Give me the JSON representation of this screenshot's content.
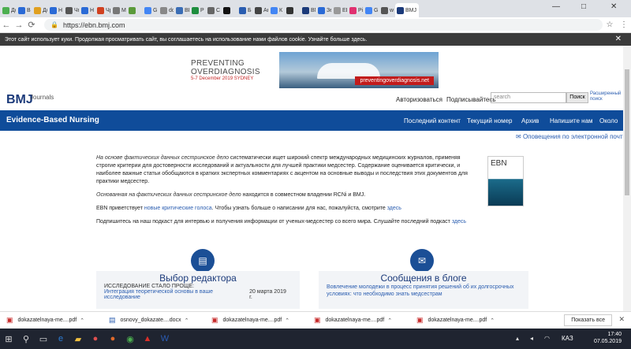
{
  "browser": {
    "tabs": [
      "Дс",
      "В",
      "Дс",
      "Н",
      "Чп",
      "Н",
      "Чр",
      "М",
      "",
      "G",
      "dc",
      "ВЕ",
      "Р",
      "С",
      "",
      "Б",
      "Ан",
      "К",
      "",
      "BMJ",
      "Зе",
      "ЕЕ",
      "Pi",
      "G",
      "w",
      "BMJ"
    ],
    "active_tab": "BMJ",
    "url": "https://ebn.bmj.com",
    "window_controls": [
      "—",
      "□",
      "✕"
    ]
  },
  "cookie_notice": "Этот сайт использует куки. Продолжая просматривать сайт, вы соглашаетесь на использование нами файлов cookie. Узнайте больше здесь.",
  "banner": {
    "line1": "PREVENTING",
    "line2": "OVERDIAGNOSIS",
    "date": "5-7 December 2019",
    "city": "SYDNEY",
    "url": "preventingoverdiagnosis.net"
  },
  "header": {
    "logo": "BMJ",
    "logo_sub": "Journals",
    "login": "Авторизоваться",
    "subscribe": "Подписывайтесь",
    "search_placeholder": "search",
    "search_button": "Поиск",
    "advanced_search": "Расширенный поиск"
  },
  "nav": {
    "title": "Evidence-Based Nursing",
    "items": [
      "Последний контент",
      "Текущий номер",
      "Архив",
      "Напишите нам",
      "Около"
    ]
  },
  "alerts": "Оповещения по электронной почте",
  "content": {
    "p1_italic": "На основе фактических данных сестринское дело",
    "p1_text": " систематически ищет широкий спектр международных медицинских журналов, применяя строгие критерии для достоверности исследований и актуальности для лучшей практики медсестер. Содержание оценивается критически, и наиболее важные статьи обобщаются в кратких экспертных комментариях с акцентом на основные выводы и последствия этих документов для практики медсестер.",
    "p2_italic": "Основанная на фактических данных сестринское дело",
    "p2_text": " находится в совместном владении RCNi и BMJ.",
    "p3_text": "EBN приветствует ",
    "p3_link": "новые критические голоса",
    "p3_rest": ". Чтобы узнать больше о написании для нас, пожалуйста, смотрите ",
    "p3_link2": "здесь",
    "p4_text": "Подпишитесь на наш подкаст для интервью и получения информации от ученых-медсестер со всего мира. Слушайте последний подкаст ",
    "p4_link": "здесь",
    "cover_label": "EBN"
  },
  "cards": [
    {
      "title": "Выбор редактора",
      "subtitle": "ИССЛЕДОВАНИЕ СТАЛО ПРОЩЕ:",
      "link": "Интеграция теоретической основы в ваше исследование",
      "date": "20 марта 2019 г."
    },
    {
      "title": "Сообщения в блоге",
      "link": "Вовлечение молодежи в процесс принятия решений об их долгосрочных условиях: что необходимо знать медсестрам"
    }
  ],
  "downloads": {
    "items": [
      {
        "name": "dokazatelnaya-me....pdf",
        "type": "pdf"
      },
      {
        "name": "osnovy_dokazate....docx",
        "type": "doc"
      },
      {
        "name": "dokazatelnaya-me....pdf",
        "type": "pdf"
      },
      {
        "name": "dokazatelnaya-me....pdf",
        "type": "pdf"
      },
      {
        "name": "dokazatelnaya-me....pdf",
        "type": "pdf"
      }
    ],
    "show_all": "Показать все"
  },
  "taskbar": {
    "lang": "КАЗ",
    "time": "17:40",
    "date": "07.05.2019"
  }
}
